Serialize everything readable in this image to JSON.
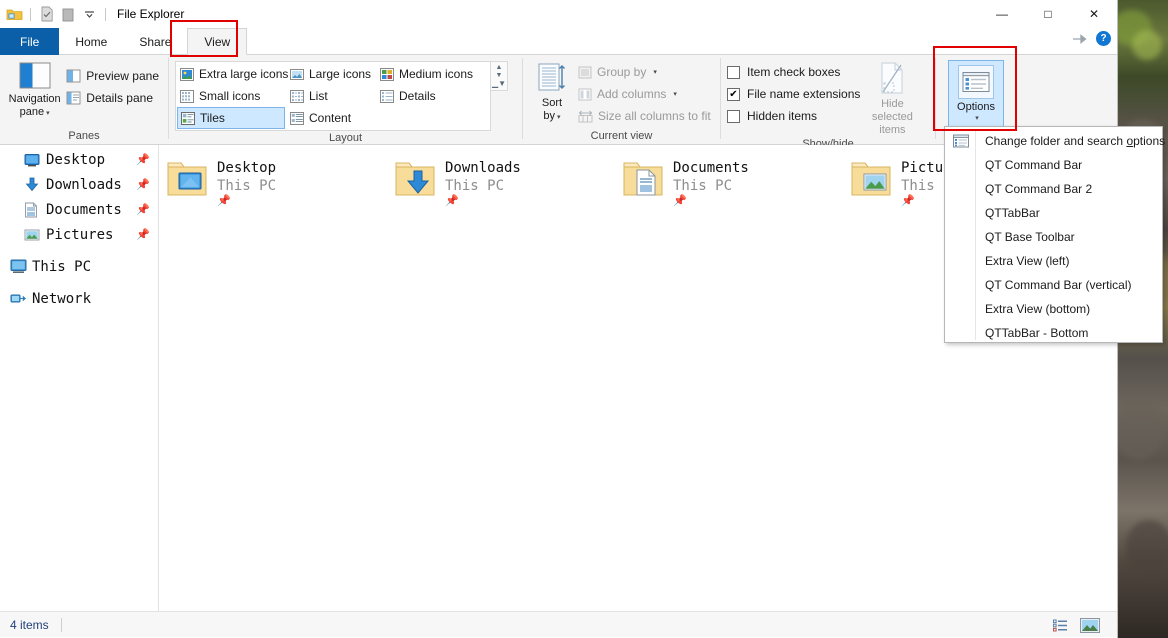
{
  "window": {
    "title": "File Explorer",
    "quick_access_icons": [
      "folder-icon",
      "properties-icon",
      "new-folder-icon",
      "customize-qat-chevron-icon"
    ],
    "controls": {
      "minimize": "—",
      "maximize": "□",
      "close": "✕"
    },
    "help_label": "?",
    "collapse_ribbon_icon": "collapse-ribbon-icon"
  },
  "tabs": [
    {
      "id": "file",
      "label": "File"
    },
    {
      "id": "home",
      "label": "Home"
    },
    {
      "id": "share",
      "label": "Share"
    },
    {
      "id": "view",
      "label": "View"
    }
  ],
  "active_tab": "View",
  "ribbon": {
    "groups": [
      {
        "id": "panes",
        "label": "Panes",
        "big_button": {
          "label": "Navigation\npane",
          "line1": "Navigation",
          "line2": "pane",
          "icon": "navigation-pane-icon",
          "has_dropdown": true
        },
        "small_buttons": [
          {
            "label": "Preview pane",
            "icon": "preview-pane-icon"
          },
          {
            "label": "Details pane",
            "icon": "details-pane-icon"
          }
        ]
      },
      {
        "id": "layout",
        "label": "Layout",
        "gallery": [
          {
            "label": "Extra large icons",
            "icon": "extra-large-icons-icon",
            "selected": false
          },
          {
            "label": "Large icons",
            "icon": "large-icons-icon",
            "selected": false
          },
          {
            "label": "Medium icons",
            "icon": "medium-icons-icon",
            "selected": false
          },
          {
            "label": "Small icons",
            "icon": "small-icons-icon",
            "selected": false
          },
          {
            "label": "List",
            "icon": "list-icon",
            "selected": false
          },
          {
            "label": "Details",
            "icon": "details-icon",
            "selected": false
          },
          {
            "label": "Tiles",
            "icon": "tiles-icon",
            "selected": true
          },
          {
            "label": "Content",
            "icon": "content-icon",
            "selected": false
          }
        ],
        "scroll_buttons": [
          "scroll-up-icon",
          "scroll-down-icon",
          "expand-gallery-icon"
        ]
      },
      {
        "id": "current-view",
        "label": "Current view",
        "big_button": {
          "line1": "Sort",
          "line2": "by",
          "icon": "sort-by-icon",
          "has_dropdown": true
        },
        "small_buttons": [
          {
            "label": "Group by",
            "icon": "group-by-icon",
            "has_dropdown": true,
            "disabled": true
          },
          {
            "label": "Add columns",
            "icon": "add-columns-icon",
            "has_dropdown": true,
            "disabled": true
          },
          {
            "label": "Size all columns to fit",
            "icon": "size-columns-icon",
            "disabled": true
          }
        ]
      },
      {
        "id": "show-hide",
        "label": "Show/hide",
        "checkboxes": [
          {
            "label": "Item check boxes",
            "checked": false
          },
          {
            "label": "File name extensions",
            "checked": true
          },
          {
            "label": "Hidden items",
            "checked": false
          }
        ],
        "big_button": {
          "line1": "Hide selected",
          "line2": "items",
          "icon": "hide-selected-items-icon",
          "disabled": true
        }
      },
      {
        "id": "options",
        "label": "",
        "options_button": {
          "label": "Options",
          "icon": "options-icon",
          "has_dropdown": true,
          "selected": true
        }
      }
    ]
  },
  "options_menu": {
    "items": [
      {
        "label": "Change folder and search options",
        "accel": "o",
        "icon": "folder-options-icon"
      },
      {
        "label": "QT Command Bar",
        "icon": null
      },
      {
        "label": "QT Command Bar 2",
        "icon": null
      },
      {
        "label": "QTTabBar",
        "icon": null
      },
      {
        "label": "QT Base Toolbar",
        "icon": null
      },
      {
        "label": "Extra View (left)",
        "icon": null
      },
      {
        "label": "QT Command Bar (vertical)",
        "icon": null
      },
      {
        "label": "Extra View (bottom)",
        "icon": null
      },
      {
        "label": "QTTabBar - Bottom",
        "icon": null
      }
    ]
  },
  "navigation_pane": {
    "items": [
      {
        "label": "Desktop",
        "icon": "desktop-icon",
        "pinned": true,
        "indent": true
      },
      {
        "label": "Downloads",
        "icon": "downloads-icon",
        "pinned": true,
        "indent": true
      },
      {
        "label": "Documents",
        "icon": "documents-icon",
        "pinned": true,
        "indent": true
      },
      {
        "label": "Pictures",
        "icon": "pictures-icon",
        "pinned": true,
        "indent": true
      },
      {
        "label": "This PC",
        "icon": "this-pc-icon",
        "pinned": false,
        "indent": false
      },
      {
        "label": "Network",
        "icon": "network-icon",
        "pinned": false,
        "indent": false
      }
    ],
    "pin_glyph": "📌"
  },
  "content": {
    "tiles": [
      {
        "name": "Desktop",
        "sub": "This PC",
        "icon": "folder-desktop-icon",
        "pinned": true
      },
      {
        "name": "Downloads",
        "sub": "This PC",
        "icon": "folder-downloads-icon",
        "pinned": true
      },
      {
        "name": "Documents",
        "sub": "This PC",
        "icon": "folder-documents-icon",
        "pinned": true
      },
      {
        "name": "Pictures",
        "sub": "This PC",
        "icon": "folder-pictures-icon",
        "pinned": true
      }
    ]
  },
  "status_bar": {
    "item_count": "4 items",
    "view_buttons": [
      {
        "name": "details-view-button",
        "active": false
      },
      {
        "name": "large-icons-view-button",
        "active": false
      }
    ]
  },
  "annotations": {
    "highlight_color": "#e00000",
    "boxes": [
      {
        "name": "view-tab-highlight"
      },
      {
        "name": "options-button-highlight"
      }
    ]
  }
}
